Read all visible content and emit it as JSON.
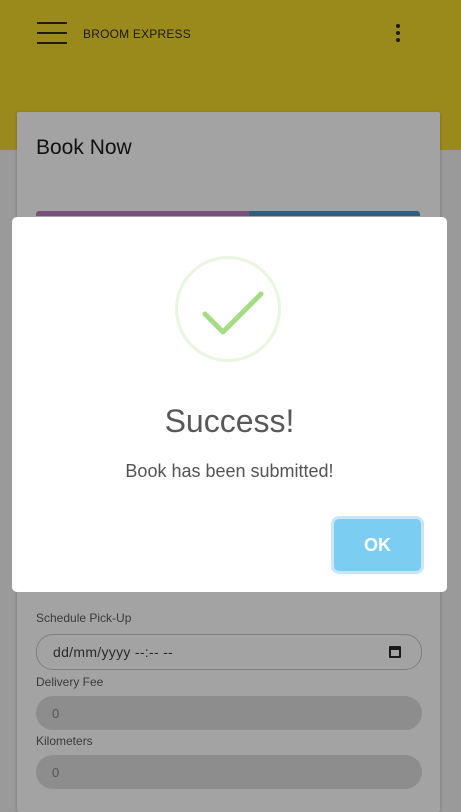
{
  "header": {
    "app_title": "BROOM EXPRESS",
    "menu_icon": "hamburger-menu-icon",
    "more_icon": "more-vertical-icon"
  },
  "card": {
    "title": "Book Now",
    "step_colors": [
      "#7a4f7c",
      "#2e5f80"
    ]
  },
  "form": {
    "schedule_label": "Schedule Pick-Up",
    "schedule_value": "dd/mm/yyyy --:-- --",
    "delivery_fee_label": "Delivery Fee",
    "delivery_fee_value": "0",
    "kilometers_label": "Kilometers",
    "kilometers_value": "0"
  },
  "dialog": {
    "icon": "success-check-icon",
    "title": "Success!",
    "message": "Book has been submitted!",
    "ok_label": "OK",
    "accent": "#7ccdf2",
    "success_color": "#a5dc86"
  }
}
